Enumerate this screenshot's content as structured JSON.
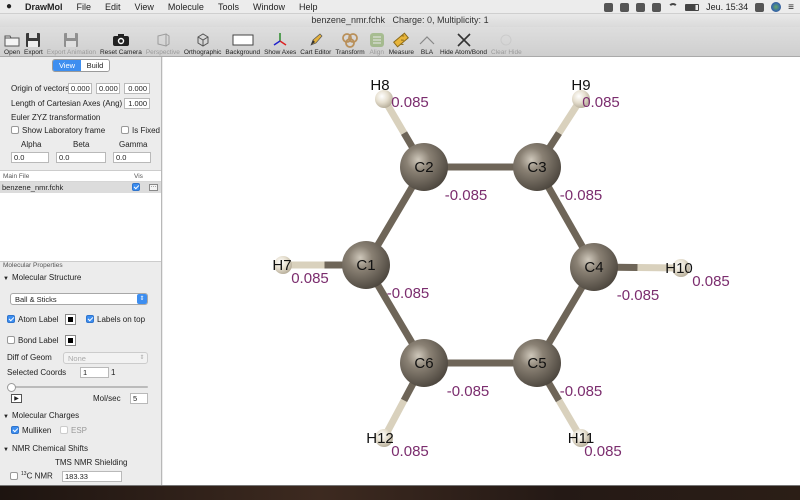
{
  "menubar": {
    "app_name": "DrawMol",
    "items": [
      "File",
      "Edit",
      "View",
      "Molecule",
      "Tools",
      "Window",
      "Help"
    ],
    "clock": "Jeu. 15:34"
  },
  "window": {
    "title": "benzene_nmr.fchk",
    "charge_label": "Charge:",
    "charge_value": "0,",
    "multiplicity_label": "Multiplicity:",
    "multiplicity_value": "1"
  },
  "toolbar": [
    {
      "name": "open",
      "label": "Open",
      "icon": "folder-icon",
      "enabled": true
    },
    {
      "name": "export",
      "label": "Export",
      "icon": "floppy-icon",
      "enabled": true
    },
    {
      "name": "export-animation",
      "label": "Export Animation",
      "icon": "floppy-icon",
      "enabled": false
    },
    {
      "name": "reset-camera",
      "label": "Reset Camera",
      "icon": "camera-icon",
      "enabled": true
    },
    {
      "name": "perspective",
      "label": "Perspective",
      "icon": "perspective-icon",
      "enabled": false
    },
    {
      "name": "orthographic",
      "label": "Orthographic",
      "icon": "cube-icon",
      "enabled": true
    },
    {
      "name": "background",
      "label": "Background",
      "icon": "rectangle-icon",
      "enabled": true
    },
    {
      "name": "show-axes",
      "label": "Show Axes",
      "icon": "axes-icon",
      "enabled": true
    },
    {
      "name": "cart-editor",
      "label": "Cart Editor",
      "icon": "pencil-icon",
      "enabled": true
    },
    {
      "name": "transform",
      "label": "Transform",
      "icon": "rings-icon",
      "enabled": true
    },
    {
      "name": "align",
      "label": "Align",
      "icon": "align-icon",
      "enabled": false
    },
    {
      "name": "measure",
      "label": "Measure",
      "icon": "ruler-icon",
      "enabled": true
    },
    {
      "name": "bla",
      "label": "BLA",
      "icon": "angle-icon",
      "enabled": true
    },
    {
      "name": "hide-atom-bond",
      "label": "Hide Atom/Bond",
      "icon": "x-icon",
      "enabled": true
    },
    {
      "name": "clear-hide",
      "label": "Clear Hide",
      "icon": "clear-icon",
      "enabled": false
    }
  ],
  "sidebar": {
    "tabs": {
      "view": "View",
      "build": "Build",
      "active": "view"
    },
    "origin_label": "Origin of vectors",
    "origin": [
      "0.000",
      "0.000",
      "0.000"
    ],
    "axes_length_label": "Length of Cartesian Axes (Ang)",
    "axes_length": "1.000",
    "euler_label": "Euler ZYZ transformation",
    "show_lab_frame": "Show Laboratory frame",
    "is_fixed": "Is Fixed",
    "alpha_label": "Alpha",
    "beta_label": "Beta",
    "gamma_label": "Gamma",
    "alpha": "0.0",
    "beta": "0.0",
    "gamma": "0.0",
    "file_table": {
      "col_main": "Main File",
      "col_vis": "Vis",
      "file": "benzene_nmr.fchk",
      "visible": true
    },
    "mol_props_label": "Molecular Properties",
    "mol_structure_label": "Molecular Structure",
    "structure_style": "Ball & Sticks",
    "atom_label": "Atom Label",
    "atom_label_checked": true,
    "labels_on_top": "Labels on top",
    "labels_on_top_checked": true,
    "bond_label": "Bond Label",
    "bond_label_checked": false,
    "diff_geom_label": "Diff of Geom",
    "diff_geom_value": "None",
    "selected_coords_label": "Selected Coords",
    "selected_coords": "1",
    "selected_coords_total": "1",
    "slider_level": 0,
    "mol_sec_label": "Mol/sec",
    "mol_sec": "5",
    "mol_charges_label": "Molecular Charges",
    "mulliken": "Mulliken",
    "mulliken_checked": true,
    "esp": "ESP",
    "esp_checked": false,
    "nmr_label": "NMR Chemical Shifts",
    "tms_label": "TMS NMR Shielding",
    "c13_sup": "13",
    "c13_label": "C NMR",
    "c13_value": "183.33"
  },
  "molecule": {
    "colors": {
      "carbon": "#7d7468",
      "hydrogen": "#e3dccb",
      "bond": "#6e6558",
      "h_bond": "#d9d1bd",
      "charge": "#7b2d6e"
    },
    "atoms": [
      {
        "label": "C1",
        "charge": "-0.085"
      },
      {
        "label": "C2",
        "charge": "-0.085"
      },
      {
        "label": "C3",
        "charge": "-0.085"
      },
      {
        "label": "C4",
        "charge": "-0.085"
      },
      {
        "label": "C5",
        "charge": "-0.085"
      },
      {
        "label": "C6",
        "charge": "-0.085"
      },
      {
        "label": "H7",
        "charge": "0.085"
      },
      {
        "label": "H8",
        "charge": "0.085"
      },
      {
        "label": "H9",
        "charge": "0.085"
      },
      {
        "label": "H10",
        "charge": "0.085"
      },
      {
        "label": "H11",
        "charge": "0.085"
      },
      {
        "label": "H12",
        "charge": "0.085"
      }
    ]
  }
}
